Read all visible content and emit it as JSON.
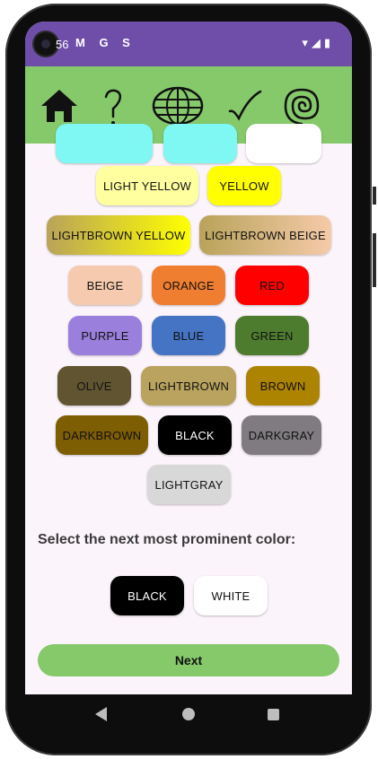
{
  "status_bar": {
    "time": "56",
    "left_icons": "M G S",
    "right_icons": "▾◢▮"
  },
  "toolbar": {
    "icons": [
      "home-icon",
      "help-icon",
      "globe-icon",
      "check-icon",
      "spiral-icon"
    ]
  },
  "colors": {
    "status_bar": "#6e4ea8",
    "toolbar": "#85c96b",
    "background": "#fcf4fb",
    "next_button": "#85c96b"
  },
  "color_chips": [
    {
      "label": "",
      "bg": "#7ff7f2"
    },
    {
      "label": "",
      "bg": "#7ff7f2"
    },
    {
      "label": "",
      "bg": "#ffffff"
    },
    {
      "label": "LIGHT YELLOW",
      "bg": "#ffffa0"
    },
    {
      "label": "YELLOW",
      "bg": "#ffff00"
    },
    {
      "label": "LIGHTBROWN YELLOW",
      "bg": "linear-gradient(90deg,#b9a35a,#ffff00)"
    },
    {
      "label": "LIGHTBROWN BEIGE",
      "bg": "linear-gradient(90deg,#b9a35a,#f5caa9)"
    },
    {
      "label": "BEIGE",
      "bg": "#f5caae"
    },
    {
      "label": "ORANGE",
      "bg": "#f07e30"
    },
    {
      "label": "RED",
      "bg": "#ff0000"
    },
    {
      "label": "PURPLE",
      "bg": "#9b7fdc"
    },
    {
      "label": "BLUE",
      "bg": "#4574c4"
    },
    {
      "label": "GREEN",
      "bg": "#4e7c2f"
    },
    {
      "label": "OLIVE",
      "bg": "#615531"
    },
    {
      "label": "LIGHTBROWN",
      "bg": "#b9a35e"
    },
    {
      "label": "BROWN",
      "bg": "#ad8302"
    },
    {
      "label": "DARKBROWN",
      "bg": "#7d5e03"
    },
    {
      "label": "BLACK",
      "bg": "#000000",
      "text": "#ffffff"
    },
    {
      "label": "DARKGRAY",
      "bg": "#7f7b80"
    },
    {
      "label": "LIGHTGRAY",
      "bg": "#d9d8d9"
    }
  ],
  "question": "Select the next most prominent color:",
  "choices": [
    {
      "label": "BLACK",
      "bg": "#000000",
      "text": "#ffffff"
    },
    {
      "label": "WHITE",
      "bg": "#ffffff",
      "text": "#111111"
    }
  ],
  "next_label": "Next"
}
